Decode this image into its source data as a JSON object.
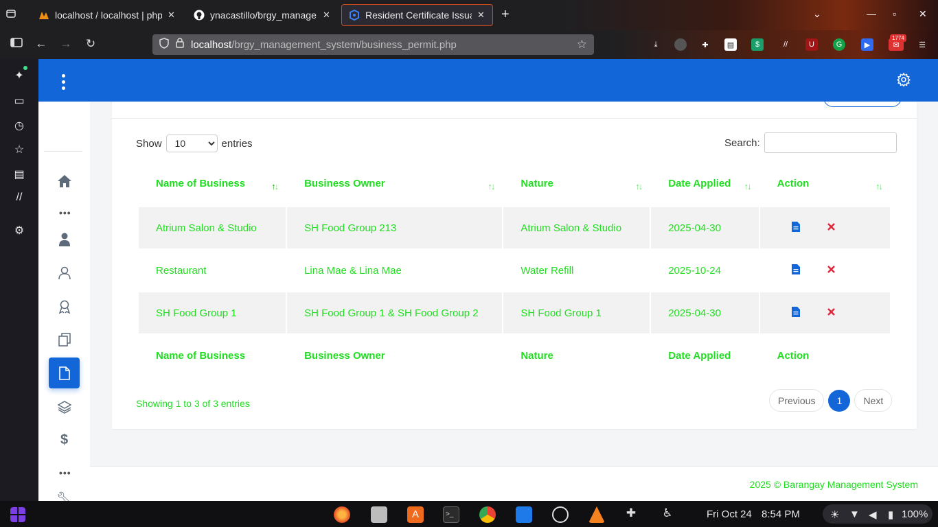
{
  "browser": {
    "tabs": [
      {
        "title": "localhost / localhost | php",
        "icon": "phpmyadmin-icon",
        "active": false
      },
      {
        "title": "ynacastillo/brgy_manage",
        "icon": "github-icon",
        "active": false
      },
      {
        "title": "Resident Certificate Issua",
        "icon": "app-favicon-icon",
        "active": true
      }
    ],
    "url_host": "localhost",
    "url_path": "/brgy_management_system/business_permit.php",
    "extension_badge": "1774"
  },
  "page": {
    "length_label_before": "Show",
    "length_value": "10",
    "length_options": [
      "10"
    ],
    "length_label_after": "entries",
    "search_label": "Search:",
    "search_value": "",
    "columns": [
      "Name of Business",
      "Business Owner",
      "Nature",
      "Date Applied",
      "Action"
    ],
    "rows": [
      {
        "name": "Atrium Salon & Studio",
        "owner": "SH Food Group 213",
        "nature": "Atrium Salon & Studio",
        "date": "2025-04-30"
      },
      {
        "name": "Restaurant",
        "owner": "Lina Mae & Lina Mae",
        "nature": "Water Refill",
        "date": "2025-10-24"
      },
      {
        "name": "SH Food Group 1",
        "owner": "SH Food Group 1 & SH Food Group 2",
        "nature": "SH Food Group 1",
        "date": "2025-04-30"
      }
    ],
    "info": "Showing 1 to 3 of 3 entries",
    "pagination": {
      "previous": "Previous",
      "current": "1",
      "next": "Next"
    },
    "footer": "2025 © Barangay Management System",
    "colors": {
      "primary": "#1266d8",
      "text_green": "#22dd22",
      "danger": "#e0243a"
    }
  },
  "taskbar": {
    "date": "Fri Oct 24",
    "time": "8:54 PM",
    "battery": "100%"
  }
}
